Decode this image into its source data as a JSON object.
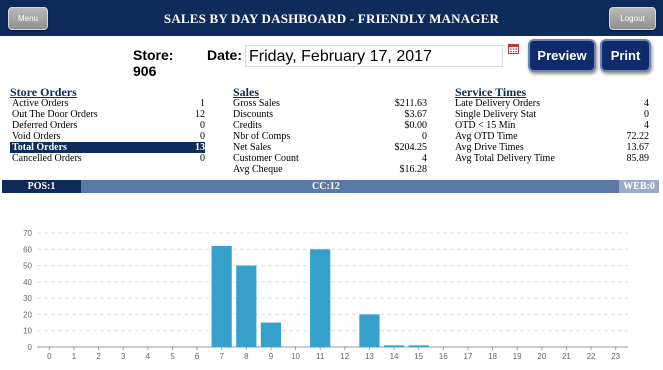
{
  "header": {
    "title": "SALES BY DAY DASHBOARD - FRIENDLY MANAGER",
    "menu_label": "Menu",
    "logout_label": "Logout"
  },
  "toolbar": {
    "store_label": "Store: 906",
    "date_label": "Date:",
    "date_value": "Friday, February 17, 2017",
    "calendar_icon": "calendar-icon",
    "preview_label": "Preview",
    "print_label": "Print"
  },
  "store_orders": {
    "title": "Store Orders",
    "rows": [
      {
        "label": "Active Orders",
        "value": "1"
      },
      {
        "label": "Out The Door Orders",
        "value": "12"
      },
      {
        "label": "Deferred Orders",
        "value": "0"
      },
      {
        "label": "Void Orders",
        "value": "0"
      },
      {
        "label": "Total Orders",
        "value": "13"
      },
      {
        "label": "Cancelled Orders",
        "value": "0"
      }
    ]
  },
  "sales": {
    "title": "Sales",
    "rows": [
      {
        "label": "Gross Sales",
        "value": "$211.63"
      },
      {
        "label": "Discounts",
        "value": "$3.67"
      },
      {
        "label": "Credits",
        "value": "$0.00"
      },
      {
        "label": "Nbr of Comps",
        "value": "0"
      },
      {
        "label": "Net Sales",
        "value": "$204.25"
      },
      {
        "label": "Customer Count",
        "value": "4"
      },
      {
        "label": "Avg Cheque",
        "value": "$16.28"
      }
    ]
  },
  "service_times": {
    "title": "Service Times",
    "rows": [
      {
        "label": "Late Delivery Orders",
        "value": "4"
      },
      {
        "label": "Single Delivery Stat",
        "value": "0"
      },
      {
        "label": "OTD < 15 Min",
        "value": "4"
      },
      {
        "label": "Avg OTD Time",
        "value": "72.22"
      },
      {
        "label": "Avg Drive Times",
        "value": "13.67"
      },
      {
        "label": "Avg Total Delivery Time",
        "value": "85.89"
      }
    ]
  },
  "status_bar": {
    "pos": "POS:1",
    "cc": "CC:12",
    "web": "WEB:0"
  },
  "colors": {
    "navy": "#0f2b5b",
    "bar": "#35a0cc",
    "status_mid": "#5a78a8",
    "status_light": "#9aaccb"
  },
  "chart_data": {
    "type": "bar",
    "categories": [
      "0",
      "1",
      "2",
      "3",
      "4",
      "5",
      "6",
      "7",
      "8",
      "9",
      "10",
      "11",
      "12",
      "13",
      "14",
      "15",
      "16",
      "17",
      "18",
      "19",
      "20",
      "21",
      "22",
      "23"
    ],
    "values": [
      0,
      0,
      0,
      0,
      0,
      0,
      0,
      62,
      50,
      15,
      0,
      60,
      0,
      20,
      1,
      1,
      0,
      0,
      0,
      0,
      0,
      0,
      0,
      0
    ],
    "ylim": [
      0,
      70
    ],
    "yticks": [
      "0",
      "10",
      "20",
      "30",
      "40",
      "50",
      "60",
      "70"
    ],
    "grid": true
  }
}
